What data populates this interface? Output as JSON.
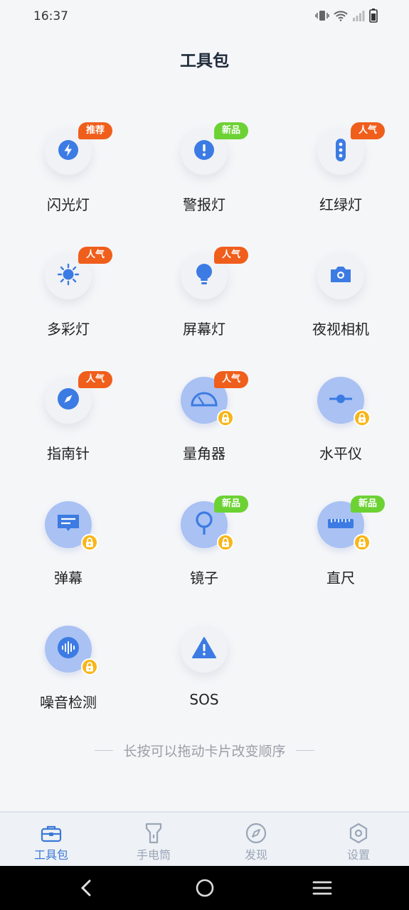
{
  "status": {
    "time": "16:37"
  },
  "header": {
    "title": "工具包"
  },
  "tools": [
    {
      "label": "闪光灯",
      "icon": "lightning-icon",
      "badge": "推荐",
      "badge_color": "#f05e1c",
      "locked": false
    },
    {
      "label": "警报灯",
      "icon": "alert-icon",
      "badge": "新品",
      "badge_color": "#6cd234",
      "locked": false
    },
    {
      "label": "红绿灯",
      "icon": "traffic-light-icon",
      "badge": "人气",
      "badge_color": "#f05e1c",
      "locked": false
    },
    {
      "label": "多彩灯",
      "icon": "sun-icon",
      "badge": "人气",
      "badge_color": "#f05e1c",
      "locked": false
    },
    {
      "label": "屏幕灯",
      "icon": "bulb-icon",
      "badge": "人气",
      "badge_color": "#f05e1c",
      "locked": false
    },
    {
      "label": "夜视相机",
      "icon": "camera-icon",
      "badge": "",
      "locked": false
    },
    {
      "label": "指南针",
      "icon": "compass-icon",
      "badge": "人气",
      "badge_color": "#f05e1c",
      "locked": false
    },
    {
      "label": "量角器",
      "icon": "protractor-icon",
      "badge": "人气",
      "badge_color": "#f05e1c",
      "locked": true
    },
    {
      "label": "水平仪",
      "icon": "level-icon",
      "badge": "",
      "locked": true
    },
    {
      "label": "弹幕",
      "icon": "chat-icon",
      "badge": "",
      "locked": true
    },
    {
      "label": "镜子",
      "icon": "mirror-icon",
      "badge": "新品",
      "badge_color": "#6cd234",
      "locked": true
    },
    {
      "label": "直尺",
      "icon": "ruler-icon",
      "badge": "新品",
      "badge_color": "#6cd234",
      "locked": true
    },
    {
      "label": "噪音检测",
      "icon": "sound-wave-icon",
      "badge": "",
      "locked": true
    },
    {
      "label": "SOS",
      "icon": "warning-icon",
      "badge": "",
      "locked": false
    }
  ],
  "hint": "长按可以拖动卡片改变顺序",
  "tabs": [
    {
      "label": "工具包",
      "icon": "toolbox-icon",
      "active": true
    },
    {
      "label": "手电筒",
      "icon": "flashlight-icon",
      "active": false
    },
    {
      "label": "发现",
      "icon": "compass-tab-icon",
      "active": false
    },
    {
      "label": "设置",
      "icon": "settings-icon",
      "active": false
    }
  ],
  "colors": {
    "accent": "#3a78d8",
    "icon_blue": "#3c7be3",
    "lock": "#f8b619"
  }
}
